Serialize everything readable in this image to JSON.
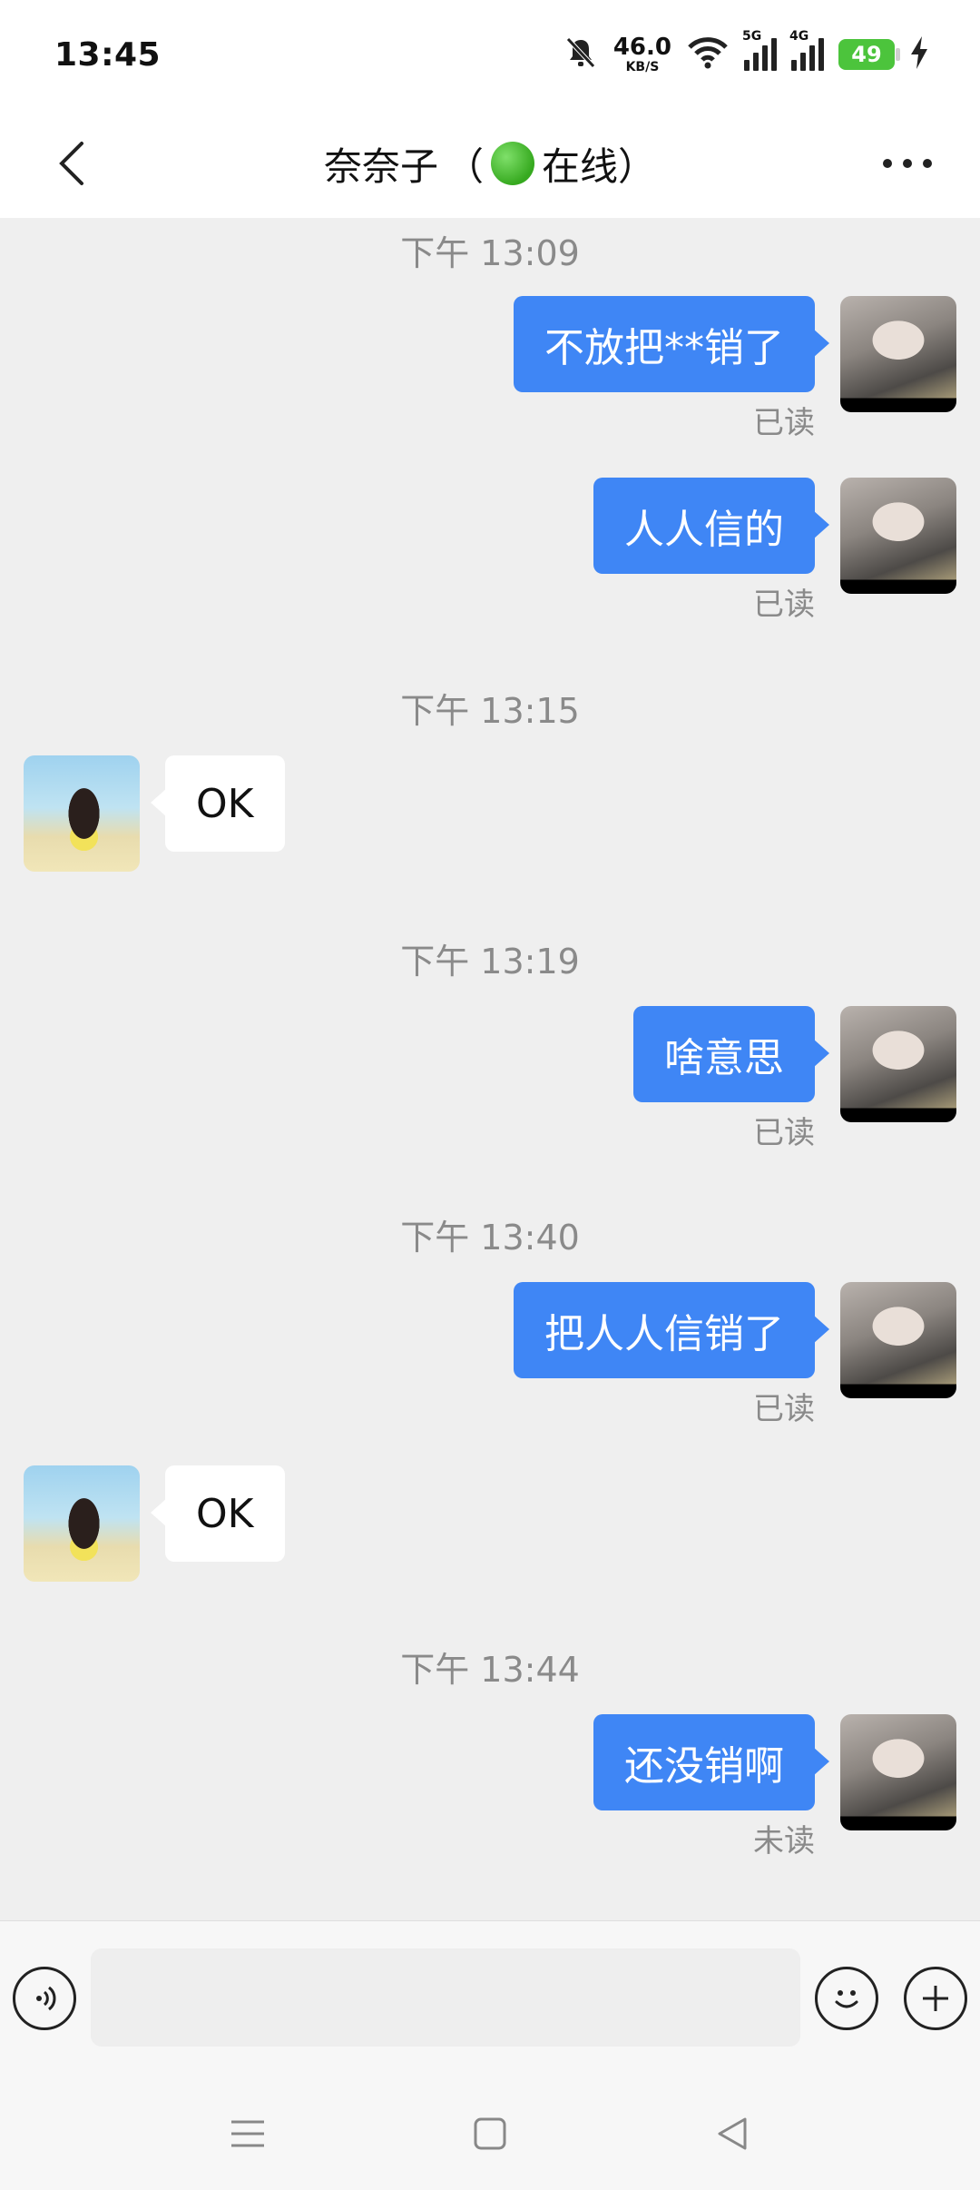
{
  "status_bar": {
    "time": "13:45",
    "net_speed_value": "46.0",
    "net_speed_unit": "KB/S",
    "sim1_tag": "5G",
    "sim2_tag": "4G",
    "battery": "49"
  },
  "header": {
    "name": "奈奈子",
    "status_open": "（",
    "status_text": "在线）"
  },
  "messages": [
    {
      "time": "下午 13:09"
    },
    {
      "side": "me",
      "text": "不放把**销了",
      "receipt": "已读"
    },
    {
      "side": "me",
      "text": "人人信的",
      "receipt": "已读"
    },
    {
      "time": "下午 13:15"
    },
    {
      "side": "peer",
      "text": "OK"
    },
    {
      "time": "下午 13:19"
    },
    {
      "side": "me",
      "text": "啥意思",
      "receipt": "已读"
    },
    {
      "time": "下午 13:40"
    },
    {
      "side": "me",
      "text": "把人人信销了",
      "receipt": "已读"
    },
    {
      "side": "peer",
      "text": "OK"
    },
    {
      "time": "下午 13:44"
    },
    {
      "side": "me",
      "text": "还没销啊",
      "receipt": "未读"
    }
  ],
  "input": {
    "value": "",
    "placeholder": ""
  },
  "icons": {
    "back": "back-arrow-icon",
    "more": "more-dots-icon",
    "voice": "voice-icon",
    "emoji": "emoji-icon",
    "plus": "plus-icon",
    "nav_menu": "menu-icon",
    "nav_home": "home-square-icon",
    "nav_back": "back-triangle-icon",
    "dnd": "bell-off-icon",
    "wifi": "wifi-icon",
    "charging": "bolt-icon"
  },
  "colors": {
    "my_bubble": "#3f86f5",
    "peer_bubble": "#ffffff",
    "background": "#efefef",
    "online": "#36a91f",
    "battery": "#4cc43c"
  }
}
